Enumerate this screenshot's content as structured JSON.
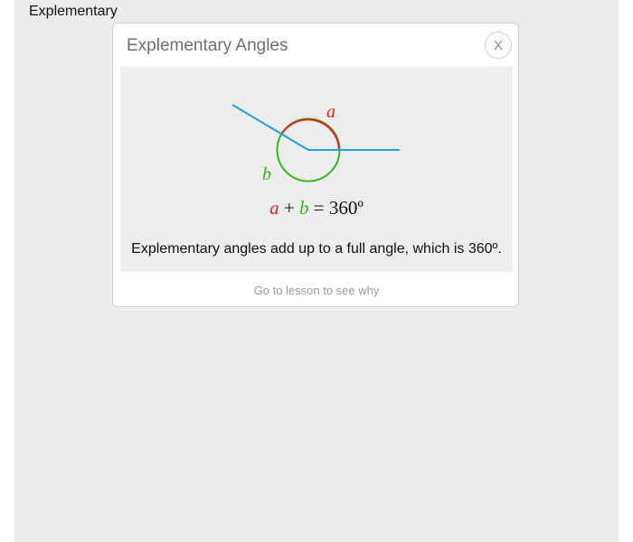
{
  "page": {
    "label": "Explementary"
  },
  "dialog": {
    "title": "Explementary Angles",
    "close_label": "X",
    "diagram": {
      "label_a": "a",
      "label_b": "b",
      "angle_colors": {
        "a": "#e0261b",
        "b": "#34b31c",
        "rays": "#1aa3e8"
      }
    },
    "formula": {
      "var_a": "a",
      "plus": "+",
      "var_b": "b",
      "equals_value": "= 360º"
    },
    "description": "Explementary angles add up to a full angle, which is 360º.",
    "lesson_link": "Go to lesson to see why"
  }
}
